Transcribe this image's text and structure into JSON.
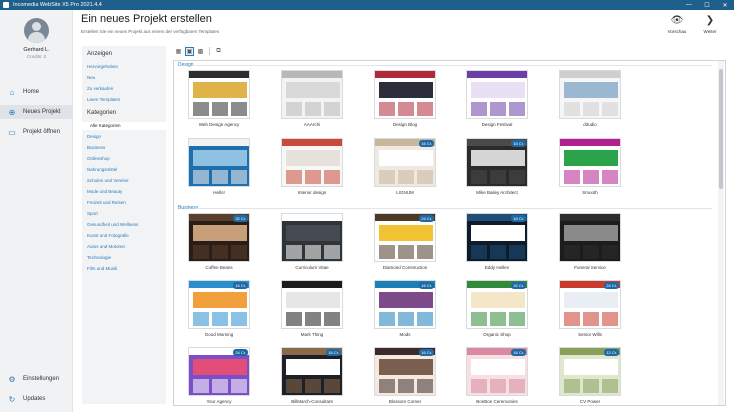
{
  "titlebar": {
    "title": "Incomedia WebSite X5 Pro 2021.4.4",
    "minimize": "—",
    "maximize": "☐",
    "close": "✕"
  },
  "user": {
    "name": "Gerhard L.",
    "credits": "Credits: 0"
  },
  "nav": {
    "home": "Home",
    "new_project": "Neues Projekt",
    "open_project": "Projekt öffnen",
    "settings": "Einstellungen",
    "updates": "Updates"
  },
  "header": {
    "title": "Ein neues Projekt erstellen",
    "subtitle": "Erstellen Sie ein neues Projekt aus einem der verfügbaren Templates",
    "preview": "Vorschau",
    "next": "Weiter"
  },
  "categories": {
    "display_header": "Anzeigen",
    "display_items": [
      "Hervorgehoben",
      "Neu",
      "Zu verkaufen",
      "Leere Templates"
    ],
    "cat_header": "Kategorien",
    "cat_items": [
      "Alle Kategorien",
      "Design",
      "Business",
      "Onlineshop",
      "Nahrungsmittel",
      "Schulen und Vereine",
      "Mode und Beauty",
      "Freizeit und Reisen",
      "Sport",
      "Gesundheit und Wellness",
      "Kunst und Fotografie",
      "Autos und Motoren",
      "Technologie",
      "Film und Musik"
    ]
  },
  "sections": {
    "design": "Design",
    "business": "Business"
  },
  "templates": [
    {
      "name": "Web Design Agency",
      "badge": ""
    },
    {
      "name": "AAArchi",
      "badge": ""
    },
    {
      "name": "Design Blog",
      "badge": ""
    },
    {
      "name": "Design Festival",
      "badge": ""
    },
    {
      "name": "d3udio",
      "badge": ""
    },
    {
      "name": "Hello!",
      "badge": ""
    },
    {
      "name": "Interior design",
      "badge": ""
    },
    {
      "name": "LIGNUM",
      "badge": "16 Cr."
    },
    {
      "name": "Mike Bailey Architect",
      "badge": "16 Cr."
    },
    {
      "name": "Smooth",
      "badge": ""
    },
    {
      "name": "Coffee Beans",
      "badge": "32 Cr."
    },
    {
      "name": "Curriculum Vitae",
      "badge": ""
    },
    {
      "name": "Diamond Construction",
      "badge": "24 Cr."
    },
    {
      "name": "Eddy Hellen",
      "badge": "16 Cr."
    },
    {
      "name": "Funeral Service",
      "badge": ""
    },
    {
      "name": "Good Morning",
      "badge": "16 Cr."
    },
    {
      "name": "Mark Thing",
      "badge": ""
    },
    {
      "name": "Mods",
      "badge": "16 Cr."
    },
    {
      "name": "Organic Shop",
      "badge": "32 Cr."
    },
    {
      "name": "Senior Wills",
      "badge": "24 Cr."
    },
    {
      "name": "Your Agency",
      "badge": "24 Cr."
    },
    {
      "name": "BillMarch-Consultant",
      "badge": "16 Cr."
    },
    {
      "name": "Blossom Corner",
      "badge": "16 Cr."
    },
    {
      "name": "BonBon Ceremonies",
      "badge": "16 Cr."
    },
    {
      "name": "CV Power",
      "badge": "12 Cr."
    }
  ],
  "colors": {
    "accent": "#2b7bb9",
    "titlebar": "#1f5f8b",
    "badge": "#1f6aa5"
  }
}
